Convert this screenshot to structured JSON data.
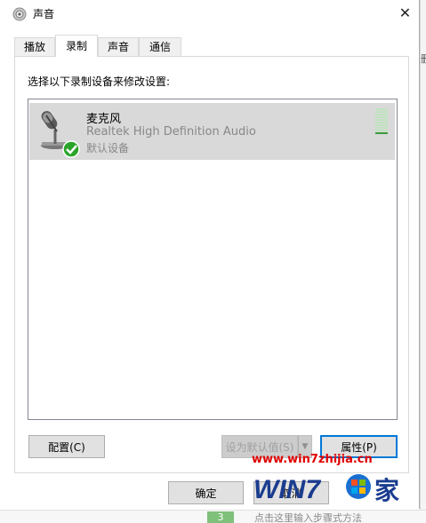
{
  "window": {
    "title": "声音"
  },
  "tabs": [
    {
      "label": "播放"
    },
    {
      "label": "录制",
      "active": true
    },
    {
      "label": "声音"
    },
    {
      "label": "通信"
    }
  ],
  "instruction": "选择以下录制设备来修改设置:",
  "devices": [
    {
      "name": "麦克风",
      "driver": "Realtek High Definition Audio",
      "status": "默认设备",
      "icon": "microphone-icon",
      "level_fraction": 0.1
    }
  ],
  "buttons": {
    "configure": "配置(C)",
    "set_default": "设为默认值(S)",
    "properties": "属性(P)",
    "ok": "确定",
    "cancel": "取消"
  },
  "background": {
    "right_fragment": "删",
    "step_number": "3",
    "hint_text": "点击这里输入步骤式方法"
  },
  "watermark": {
    "url": "www.win7zhijia.cn",
    "logo_text": "WIN7之家"
  },
  "colors": {
    "accent": "#0078d7",
    "selection": "#d9d9d9",
    "level_on": "#3a9a3a",
    "level_off": "#bfe3bf",
    "watermark_red": "#e00000",
    "default_check": "#2aa52a"
  }
}
